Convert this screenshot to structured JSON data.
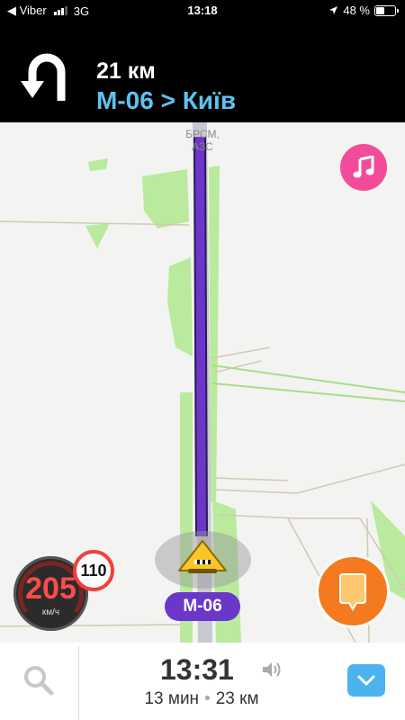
{
  "status_bar": {
    "back_label": "◀ Viber",
    "network": "3G",
    "time": "13:18",
    "battery_percent": "48 %",
    "battery_level": 0.48,
    "signal_bars": 3,
    "icons": [
      "back-arrow-icon",
      "signal-icon",
      "location-arrow-icon",
      "battery-icon"
    ]
  },
  "navigation": {
    "maneuver_icon": "u-turn-icon",
    "distance": "21 км",
    "street": "М-06 > Київ"
  },
  "map": {
    "poi_label": "БРСМ, АЗС",
    "current_road": "М-06",
    "route_color": "#6b37c9",
    "music_icon": "music-note-icon"
  },
  "speedometer": {
    "speed": "205",
    "unit": "км/ч",
    "speed_limit": "110"
  },
  "bottom_bar": {
    "search_icon": "search-icon",
    "eta": "13:31",
    "volume_icon": "speaker-icon",
    "duration": "13 мин",
    "separator": "•",
    "distance": "23 км",
    "expand_icon": "chevron-down-icon"
  },
  "colors": {
    "accent": "#5ec2ee",
    "route": "#6b37c9",
    "report_button": "#f57a1f",
    "music_button": "#f24b9a",
    "speed_warning": "#ff4b4b"
  }
}
